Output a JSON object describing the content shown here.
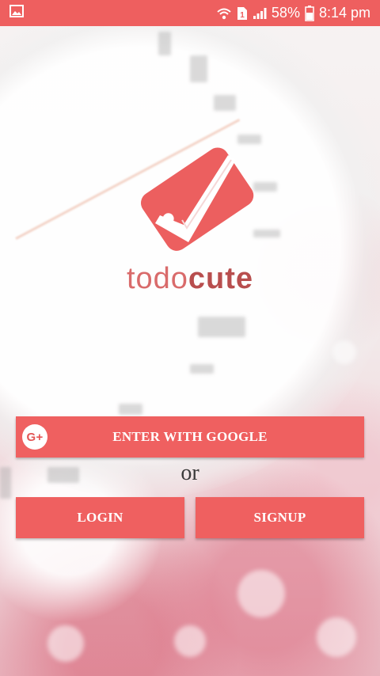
{
  "status_bar": {
    "battery_percent": "58%",
    "time": "8:14 pm",
    "sim_label": "1",
    "icons": [
      "image-icon",
      "wifi-icon",
      "sim-icon",
      "signal-icon",
      "battery-icon"
    ]
  },
  "brand": {
    "name_part1": "todo",
    "name_part2": "cute"
  },
  "actions": {
    "google_label": "ENTER WITH GOOGLE",
    "google_icon_text": "G+",
    "or_text": "or",
    "login_label": "LOGIN",
    "signup_label": "SIGNUP"
  },
  "colors": {
    "accent": "#ef6060",
    "status_bar": "#ee5f5f",
    "brand_light": "#d96b6b",
    "brand_dark": "#b84e4e"
  }
}
